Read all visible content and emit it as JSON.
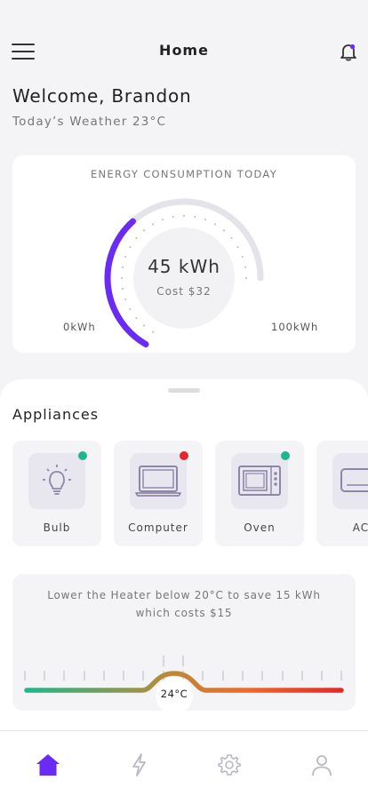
{
  "header": {
    "title": "Home",
    "menu_icon": "hamburger-menu-icon",
    "notification_icon": "bell-icon"
  },
  "greeting": {
    "welcome": "Welcome, Brandon",
    "weather": "Today’s Weather 23°C"
  },
  "energy": {
    "title": "ENERGY CONSUMPTION TODAY",
    "value": "45 kWh",
    "cost": "Cost $32",
    "min_label": "0kWh",
    "max_label": "100kWh",
    "consumption_kwh": 45,
    "max_kwh": 100
  },
  "appliances": {
    "title": "Appliances",
    "items": [
      {
        "label": "Bulb",
        "icon": "bulb-icon",
        "status": "on"
      },
      {
        "label": "Computer",
        "icon": "computer-icon",
        "status": "off"
      },
      {
        "label": "Oven",
        "icon": "oven-icon",
        "status": "on"
      },
      {
        "label": "AC",
        "icon": "ac-icon",
        "status": "on"
      }
    ]
  },
  "tip": {
    "text": "Lower the Heater below 20°C to save 15 kWh which costs $15",
    "slider_value": "24°C"
  },
  "nav": {
    "items": [
      "home-icon",
      "lightning-icon",
      "gear-icon",
      "user-icon"
    ],
    "active": 0
  },
  "colors": {
    "accent": "#6a2cf4",
    "status_on": "#1fb58f",
    "status_off": "#e0282e",
    "icon_muted": "#8e86a8",
    "nav_inactive": "#b9b9c4"
  }
}
